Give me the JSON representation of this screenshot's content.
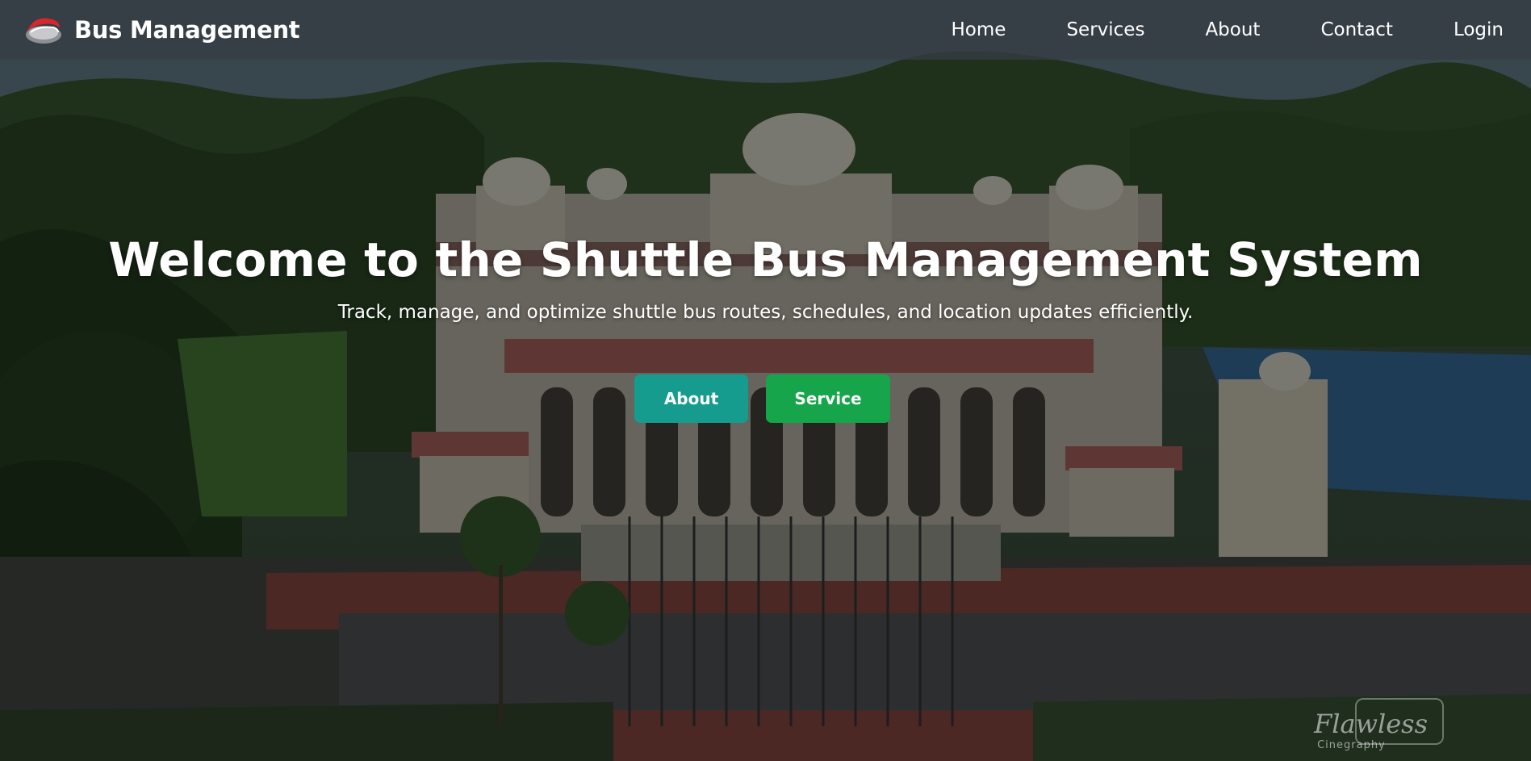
{
  "app": {
    "brand_name": "Bus Management",
    "brand_logo_icon": "bus-logo-icon"
  },
  "nav": {
    "items": [
      {
        "label": "Home"
      },
      {
        "label": "Services"
      },
      {
        "label": "About"
      },
      {
        "label": "Contact"
      },
      {
        "label": "Login"
      }
    ]
  },
  "hero": {
    "title": "Welcome to the Shuttle Bus Management System",
    "subtitle": "Track, manage, and optimize shuttle bus routes, schedules, and location updates efficiently.",
    "buttons": {
      "about_label": "About",
      "service_label": "Service"
    }
  },
  "watermark": {
    "main": "Flawless",
    "sub": "Cinegraphy"
  },
  "colors": {
    "navbar": "#373e44",
    "about_button": "#169c8f",
    "service_button": "#16a54a",
    "text": "#ffffff"
  }
}
